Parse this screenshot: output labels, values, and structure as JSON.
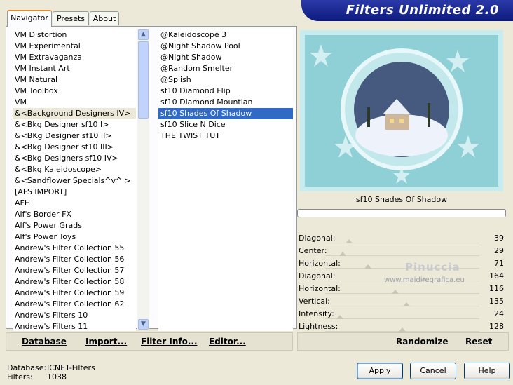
{
  "tabs": [
    {
      "label": "Navigator",
      "active": true
    },
    {
      "label": "Presets",
      "active": false
    },
    {
      "label": "About",
      "active": false
    }
  ],
  "banner": {
    "title": "Filters Unlimited 2.0"
  },
  "categories": {
    "items": [
      "VM Distortion",
      "VM Experimental",
      "VM Extravaganza",
      "VM Instant Art",
      "VM Natural",
      "VM Toolbox",
      "VM",
      "&<Background Designers IV>",
      "&<Bkg Designer sf10 I>",
      "&<BKg Designer sf10 II>",
      "&<Bkg Designer sf10 III>",
      "&<Bkg Designers sf10 IV>",
      "&<Bkg Kaleidoscope>",
      "&<Sandflower Specials^v^ >",
      "[AFS IMPORT]",
      "AFH",
      "Alf's Border FX",
      "Alf's Power Grads",
      "Alf's Power Toys",
      "Andrew's Filter Collection 55",
      "Andrew's Filter Collection 56",
      "Andrew's Filter Collection 57",
      "Andrew's Filter Collection 58",
      "Andrew's Filter Collection 59",
      "Andrew's Filter Collection 62",
      "Andrew's Filters 10",
      "Andrew's Filters 11"
    ],
    "selected_index": 7
  },
  "filters": {
    "items": [
      "@Kaleidoscope 3",
      "@Night Shadow Pool",
      "@Night Shadow",
      "@Random Smelter",
      "@Splish",
      "sf10 Diamond Flip",
      "sf10 Diamond Mountian",
      "sf10 Shades Of Shadow",
      "sf10 Slice N Dice",
      "THE TWIST TUT"
    ],
    "selected_index": 7
  },
  "preview": {
    "caption": "sf10 Shades Of Shadow"
  },
  "params": [
    {
      "label": "Diagonal:",
      "value": "39"
    },
    {
      "label": "Center:",
      "value": "29"
    },
    {
      "label": "Horizontal:",
      "value": "71"
    },
    {
      "label": "Diagonal:",
      "value": "164"
    },
    {
      "label": "Horizontal:",
      "value": "116"
    },
    {
      "label": "Vertical:",
      "value": "135"
    },
    {
      "label": "Intensity:",
      "value": "24"
    },
    {
      "label": "Lightness:",
      "value": "128"
    }
  ],
  "watermark": {
    "name": "Pinuccia",
    "url": "www.maidiregrafica.eu"
  },
  "links": {
    "database": "Database",
    "import": "Import...",
    "filter_info": "Filter Info...",
    "editor": "Editor..."
  },
  "randbar": {
    "randomize": "Randomize",
    "reset": "Reset"
  },
  "status": {
    "database_label": "Database:",
    "database_value": "ICNET-Filters",
    "filters_label": "Filters:",
    "filters_value": "1038"
  },
  "buttons": {
    "apply": "Apply",
    "cancel": "Cancel",
    "help": "Help"
  },
  "icons": {
    "scroll_up": "chevron-up-icon",
    "scroll_down": "chevron-down-icon"
  },
  "colors": {
    "accent": "#316ac5",
    "banner": "#1a2a9a"
  }
}
